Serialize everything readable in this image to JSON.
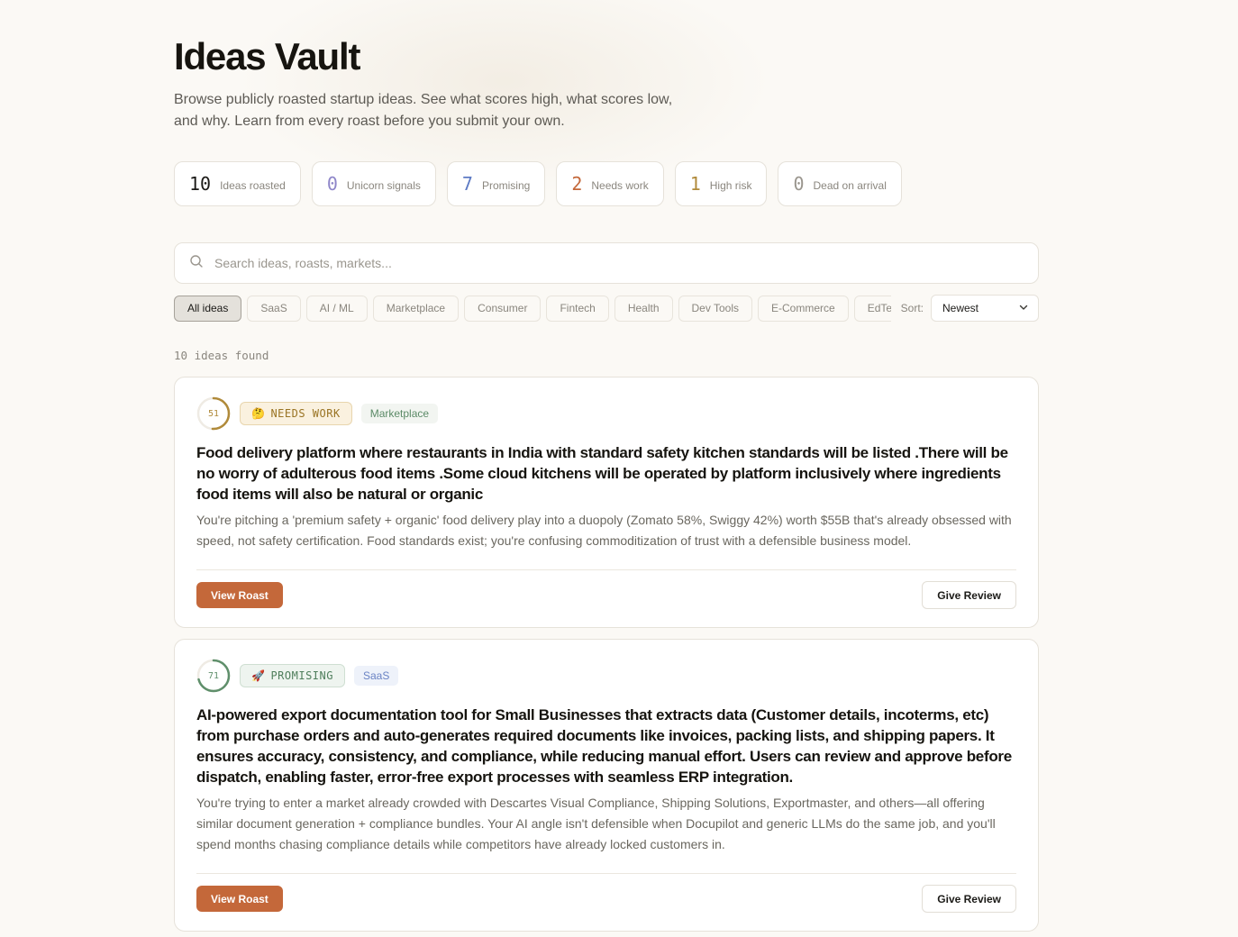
{
  "header": {
    "title": "Ideas Vault",
    "subtitle": "Browse publicly roasted startup ideas. See what scores high, what scores low, and why. Learn from every roast before you submit your own."
  },
  "stats": [
    {
      "num": "10",
      "label": "Ideas roasted",
      "color": "#1b1a17"
    },
    {
      "num": "0",
      "label": "Unicorn signals",
      "color": "#8e86c9"
    },
    {
      "num": "7",
      "label": "Promising",
      "color": "#5d7ac4"
    },
    {
      "num": "2",
      "label": "Needs work",
      "color": "#c4683a"
    },
    {
      "num": "1",
      "label": "High risk",
      "color": "#b08a3a"
    },
    {
      "num": "0",
      "label": "Dead on arrival",
      "color": "#9a968e"
    }
  ],
  "search": {
    "placeholder": "Search ideas, roasts, markets..."
  },
  "filters": [
    "All ideas",
    "SaaS",
    "AI / ML",
    "Marketplace",
    "Consumer",
    "Fintech",
    "Health",
    "Dev Tools",
    "E-Commerce",
    "EdTech"
  ],
  "sort": {
    "label": "Sort:",
    "selected": "Newest"
  },
  "results_count": "10 ideas found",
  "ideas": [
    {
      "score": "51",
      "score_fraction": 0.51,
      "score_color": "#b08a3a",
      "verdict_emoji": "🤔",
      "verdict": "NEEDS WORK",
      "category": "Marketplace",
      "title": "Food delivery platform where restaurants in India with standard safety kitchen standards will be listed .There will be no worry of adulterous food items .Some cloud kitchens will be operated by platform inclusively where ingredients food items will also be natural or organic",
      "roast": "You're pitching a 'premium safety + organic' food delivery play into a duopoly (Zomato 58%, Swiggy 42%) worth $55B that's already obsessed with speed, not safety certification. Food standards exist; you're confusing commoditization of trust with a defensible business model.",
      "view_label": "View Roast",
      "review_label": "Give Review"
    },
    {
      "score": "71",
      "score_fraction": 0.71,
      "score_color": "#5f8f6b",
      "verdict_emoji": "🚀",
      "verdict": "PROMISING",
      "category": "SaaS",
      "title": "AI-powered export documentation tool for Small Businesses that extracts data (Customer details, incoterms, etc) from purchase orders and auto-generates required documents like invoices, packing lists, and shipping papers. It ensures accuracy, consistency, and compliance, while reducing manual effort. Users can review and approve before dispatch, enabling faster, error-free export processes with seamless ERP integration.",
      "roast": "You're trying to enter a market already crowded with Descartes Visual Compliance, Shipping Solutions, Exportmaster, and others—all offering similar document generation + compliance bundles. Your AI angle isn't defensible when Docupilot and generic LLMs do the same job, and you'll spend months chasing compliance details while competitors have already locked customers in.",
      "view_label": "View Roast",
      "review_label": "Give Review"
    }
  ]
}
